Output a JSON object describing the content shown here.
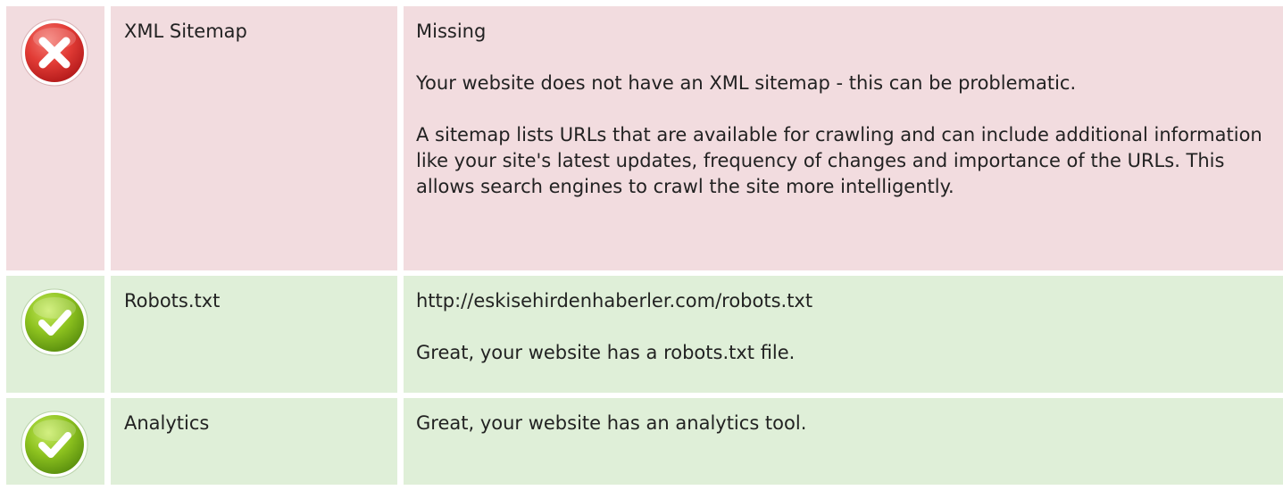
{
  "rows": [
    {
      "status": "fail",
      "icon": "error-x-icon",
      "label": "XML Sitemap",
      "detail": [
        "Missing",
        "Your website does not have an XML sitemap - this can be problematic.",
        "A sitemap lists URLs that are available for crawling and can include additional information like your site's latest updates, frequency of changes and importance of the URLs. This allows search engines to crawl the site more intelligently."
      ]
    },
    {
      "status": "pass",
      "icon": "success-check-icon",
      "label": "Robots.txt",
      "detail": [
        "http://eskisehirdenhaberler.com/robots.txt",
        "Great, your website has a robots.txt file."
      ]
    },
    {
      "status": "pass",
      "icon": "success-check-icon",
      "label": "Analytics",
      "detail": [
        "Great, your website has an analytics tool."
      ]
    }
  ],
  "colors": {
    "fail_background": "#f2dcdf",
    "pass_background": "#dfefd8",
    "error_icon": "#e03a3a",
    "success_icon": "#8dc21f"
  }
}
